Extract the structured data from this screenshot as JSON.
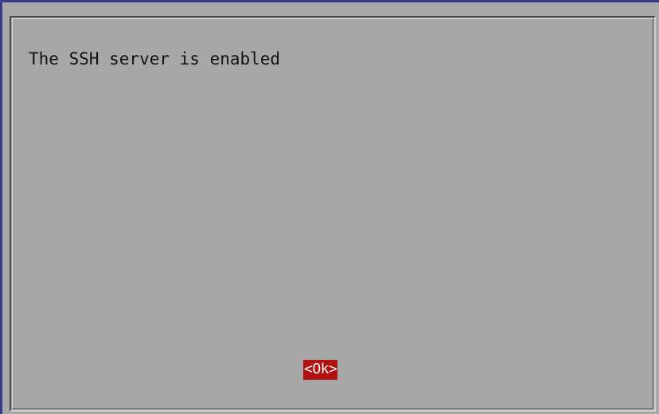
{
  "dialog": {
    "message": "The SSH server is enabled",
    "ok_button": "<Ok>"
  },
  "colors": {
    "background": "#a8a8a8",
    "ok_button_bg": "#b01010",
    "ok_button_text": "#f4f4f4",
    "text": "#111111"
  }
}
